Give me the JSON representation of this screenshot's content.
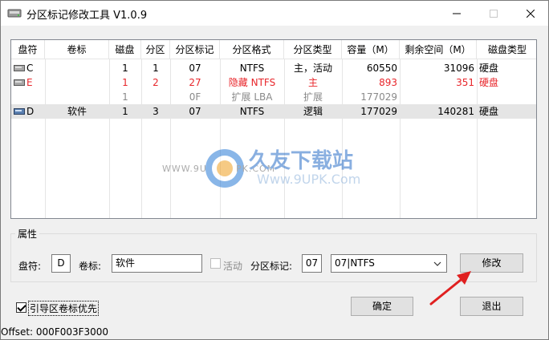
{
  "window": {
    "title": "分区标记修改工具 V1.0.9",
    "controls": {
      "minimize": "—",
      "maximize": "☐",
      "close": "✕"
    }
  },
  "table": {
    "columns": [
      "盘符",
      "卷标",
      "磁盘",
      "分区",
      "分区标记",
      "分区格式",
      "分区类型",
      "容量（M）",
      "剩余空间（M）",
      "磁盘类型"
    ],
    "rows": [
      {
        "drive": "C",
        "label": "",
        "disk": "1",
        "part": "1",
        "mark": "07",
        "format": "NTFS",
        "type": "主，活动",
        "capacity": "60550",
        "free": "31096",
        "disk_type": "硬盘",
        "style": "normal"
      },
      {
        "drive": "E",
        "label": "",
        "disk": "1",
        "part": "2",
        "mark": "27",
        "format": "隐藏 NTFS",
        "type": "主",
        "capacity": "893",
        "free": "351",
        "disk_type": "硬盘",
        "style": "red"
      },
      {
        "drive": "",
        "label": "",
        "disk": "1",
        "part": "",
        "mark": "0F",
        "format": "扩展 LBA",
        "type": "扩展",
        "capacity": "177029",
        "free": "",
        "disk_type": "",
        "style": "gray"
      },
      {
        "drive": "D",
        "label": "软件",
        "disk": "1",
        "part": "3",
        "mark": "07",
        "format": "NTFS",
        "type": "逻辑",
        "capacity": "177029",
        "free": "140281",
        "disk_type": "硬盘",
        "style": "selected"
      }
    ]
  },
  "properties": {
    "group_label": "属性",
    "drive_label": "盘符:",
    "drive_value": "D",
    "volume_label": "卷标:",
    "volume_value": "软件",
    "active_label": "活动",
    "active_checked": false,
    "mark_label": "分区标记:",
    "mark_value": "07",
    "mark_select_value": "07|NTFS",
    "modify_button": "修改"
  },
  "footer": {
    "boot_priority_label": "引导区卷标优先",
    "boot_priority_checked": true,
    "ok_button": "确定",
    "exit_button": "退出"
  },
  "status": {
    "offset": "Offset: 000F003F3000"
  },
  "watermark": {
    "brand": "久友下载站",
    "url_left": "WWW.9U",
    "url_right": "PK.COM",
    "url_big": "Www.9UPK.Com"
  },
  "colors": {
    "red_text": "#e8262b",
    "gray_text": "#8a8a8a",
    "selected_row": "#e5e5e5",
    "arrow": "#e02020"
  }
}
